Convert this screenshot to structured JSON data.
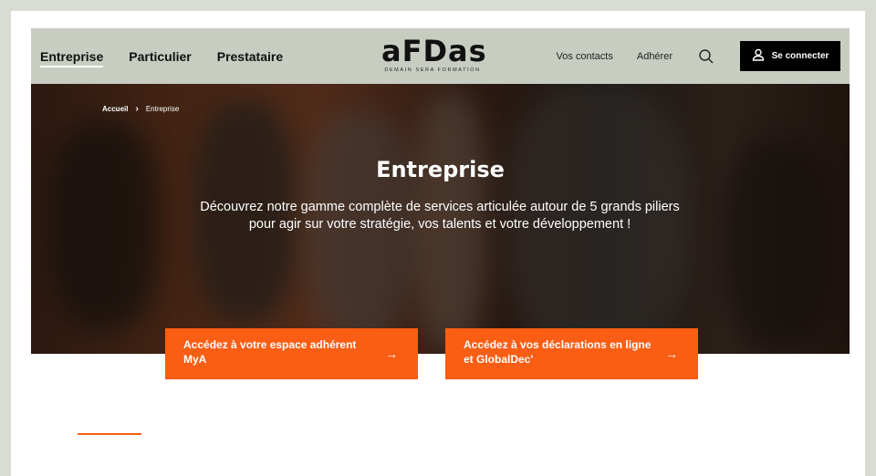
{
  "header": {
    "nav": [
      {
        "label": "Entreprise"
      },
      {
        "label": "Particulier"
      },
      {
        "label": "Prestataire"
      }
    ],
    "logo": {
      "main": "aFDas",
      "tagline": "DEMAIN SERA FORMATION"
    },
    "links": [
      {
        "label": "Vos contacts"
      },
      {
        "label": "Adhérer"
      }
    ],
    "login_label": "Se connecter"
  },
  "breadcrumb": {
    "home": "Accueil",
    "current": "Entreprise"
  },
  "hero": {
    "title": "Entreprise",
    "description": "Découvrez notre gamme complète de services articulée autour de 5 grands piliers pour agir sur votre stratégie, vos talents et votre développement !"
  },
  "cta": [
    {
      "label": "Accédez à votre espace adhérent MyA"
    },
    {
      "label": "Accédez à vos déclarations en ligne et GlobalDec'"
    }
  ],
  "colors": {
    "accent": "#fa5d14",
    "header_bg": "#c8cdc2",
    "frame_bg": "#d8dcd3"
  },
  "icons": [
    "search-icon",
    "user-icon",
    "arrow-right-icon",
    "chevron-right-icon"
  ]
}
